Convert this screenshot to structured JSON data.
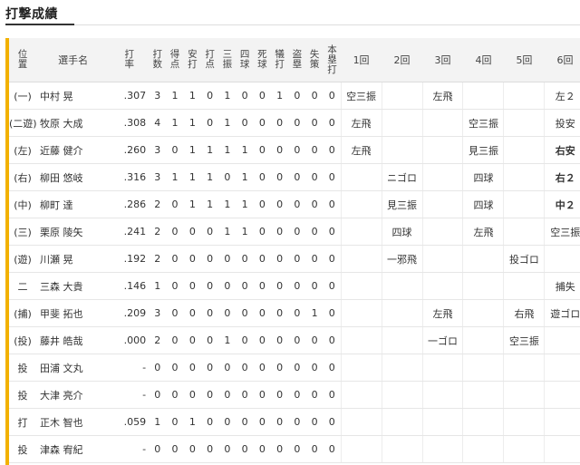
{
  "section_title": "打撃成績",
  "headers": {
    "pos": "位置",
    "name": "選手名",
    "avg": "打率",
    "ab": "打数",
    "r": "得点",
    "h": "安打",
    "rbi": "打点",
    "so": "三振",
    "bb": "四球",
    "hbp": "死球",
    "sac": "犠打",
    "sb": "盗塁",
    "err": "失策",
    "hr": "本塁打",
    "innings": [
      "1回",
      "2回",
      "3回",
      "4回",
      "5回",
      "6回"
    ]
  },
  "players": [
    {
      "pos": "(一)",
      "name": "中村 晃",
      "avg": ".307",
      "ab": "3",
      "r": "1",
      "h": "1",
      "rbi": "0",
      "so": "1",
      "bb": "0",
      "hbp": "0",
      "sac": "1",
      "sb": "0",
      "err": "0",
      "hr": "0",
      "innings": [
        "空三振",
        "",
        "左飛",
        "",
        "",
        "左２"
      ],
      "styles": [
        "",
        "",
        "",
        "",
        "",
        "hit"
      ]
    },
    {
      "pos": "(二遊)",
      "name": "牧原 大成",
      "avg": ".308",
      "ab": "4",
      "r": "1",
      "h": "1",
      "rbi": "0",
      "so": "1",
      "bb": "0",
      "hbp": "0",
      "sac": "0",
      "sb": "0",
      "err": "0",
      "hr": "0",
      "innings": [
        "左飛",
        "",
        "",
        "空三振",
        "",
        "投安"
      ],
      "styles": [
        "",
        "",
        "",
        "",
        "",
        "hit"
      ]
    },
    {
      "pos": "(左)",
      "name": "近藤 健介",
      "avg": ".260",
      "ab": "3",
      "r": "0",
      "h": "1",
      "rbi": "1",
      "so": "1",
      "bb": "1",
      "hbp": "0",
      "sac": "0",
      "sb": "0",
      "err": "0",
      "hr": "0",
      "innings": [
        "左飛",
        "",
        "",
        "見三振",
        "",
        "右安"
      ],
      "styles": [
        "",
        "",
        "",
        "",
        "",
        "hit-bold"
      ]
    },
    {
      "pos": "(右)",
      "name": "柳田 悠岐",
      "avg": ".316",
      "ab": "3",
      "r": "1",
      "h": "1",
      "rbi": "1",
      "so": "0",
      "bb": "1",
      "hbp": "0",
      "sac": "0",
      "sb": "0",
      "err": "0",
      "hr": "0",
      "innings": [
        "",
        "ニゴロ",
        "",
        "四球",
        "",
        "右２"
      ],
      "styles": [
        "",
        "",
        "",
        "",
        "",
        "hit-bold"
      ]
    },
    {
      "pos": "(中)",
      "name": "柳町 達",
      "avg": ".286",
      "ab": "2",
      "r": "0",
      "h": "1",
      "rbi": "1",
      "so": "1",
      "bb": "1",
      "hbp": "0",
      "sac": "0",
      "sb": "0",
      "err": "0",
      "hr": "0",
      "innings": [
        "",
        "見三振",
        "",
        "四球",
        "",
        "中２"
      ],
      "styles": [
        "",
        "",
        "",
        "",
        "",
        "hit-bold"
      ]
    },
    {
      "pos": "(三)",
      "name": "栗原 陵矢",
      "avg": ".241",
      "ab": "2",
      "r": "0",
      "h": "0",
      "rbi": "0",
      "so": "1",
      "bb": "1",
      "hbp": "0",
      "sac": "0",
      "sb": "0",
      "err": "0",
      "hr": "0",
      "innings": [
        "",
        "四球",
        "",
        "左飛",
        "",
        "空三振"
      ],
      "styles": [
        "",
        "",
        "",
        "",
        "",
        ""
      ]
    },
    {
      "pos": "(遊)",
      "name": "川瀬 晃",
      "avg": ".192",
      "ab": "2",
      "r": "0",
      "h": "0",
      "rbi": "0",
      "so": "0",
      "bb": "0",
      "hbp": "0",
      "sac": "0",
      "sb": "0",
      "err": "0",
      "hr": "0",
      "innings": [
        "",
        "一邪飛",
        "",
        "",
        "投ゴロ",
        ""
      ],
      "styles": [
        "",
        "",
        "",
        "",
        "",
        ""
      ]
    },
    {
      "pos": "二",
      "name": "三森 大貴",
      "avg": ".146",
      "ab": "1",
      "r": "0",
      "h": "0",
      "rbi": "0",
      "so": "0",
      "bb": "0",
      "hbp": "0",
      "sac": "0",
      "sb": "0",
      "err": "0",
      "hr": "0",
      "innings": [
        "",
        "",
        "",
        "",
        "",
        "捕失"
      ],
      "styles": [
        "",
        "",
        "",
        "",
        "",
        ""
      ]
    },
    {
      "pos": "(捕)",
      "name": "甲斐 拓也",
      "avg": ".209",
      "ab": "3",
      "r": "0",
      "h": "0",
      "rbi": "0",
      "so": "0",
      "bb": "0",
      "hbp": "0",
      "sac": "0",
      "sb": "0",
      "err": "1",
      "hr": "0",
      "innings": [
        "",
        "",
        "左飛",
        "",
        "右飛",
        "遊ゴロ"
      ],
      "styles": [
        "",
        "",
        "",
        "",
        "",
        ""
      ]
    },
    {
      "pos": "(投)",
      "name": "藤井 皓哉",
      "avg": ".000",
      "ab": "2",
      "r": "0",
      "h": "0",
      "rbi": "0",
      "so": "1",
      "bb": "0",
      "hbp": "0",
      "sac": "0",
      "sb": "0",
      "err": "0",
      "hr": "0",
      "innings": [
        "",
        "",
        "一ゴロ",
        "",
        "空三振",
        ""
      ],
      "styles": [
        "",
        "",
        "",
        "",
        "",
        ""
      ]
    },
    {
      "pos": "投",
      "name": "田浦 文丸",
      "avg": "-",
      "ab": "0",
      "r": "0",
      "h": "0",
      "rbi": "0",
      "so": "0",
      "bb": "0",
      "hbp": "0",
      "sac": "0",
      "sb": "0",
      "err": "0",
      "hr": "0",
      "innings": [
        "",
        "",
        "",
        "",
        "",
        ""
      ],
      "styles": [
        "",
        "",
        "",
        "",
        "",
        ""
      ]
    },
    {
      "pos": "投",
      "name": "大津 亮介",
      "avg": "-",
      "ab": "0",
      "r": "0",
      "h": "0",
      "rbi": "0",
      "so": "0",
      "bb": "0",
      "hbp": "0",
      "sac": "0",
      "sb": "0",
      "err": "0",
      "hr": "0",
      "innings": [
        "",
        "",
        "",
        "",
        "",
        ""
      ],
      "styles": [
        "",
        "",
        "",
        "",
        "",
        ""
      ]
    },
    {
      "pos": "打",
      "name": "正木 智也",
      "avg": ".059",
      "ab": "1",
      "r": "0",
      "h": "1",
      "rbi": "0",
      "so": "0",
      "bb": "0",
      "hbp": "0",
      "sac": "0",
      "sb": "0",
      "err": "0",
      "hr": "0",
      "innings": [
        "",
        "",
        "",
        "",
        "",
        ""
      ],
      "styles": [
        "",
        "",
        "",
        "",
        "",
        ""
      ]
    },
    {
      "pos": "投",
      "name": "津森 宥紀",
      "avg": "-",
      "ab": "0",
      "r": "0",
      "h": "0",
      "rbi": "0",
      "so": "0",
      "bb": "0",
      "hbp": "0",
      "sac": "0",
      "sb": "0",
      "err": "0",
      "hr": "0",
      "innings": [
        "",
        "",
        "",
        "",
        "",
        ""
      ],
      "styles": [
        "",
        "",
        "",
        "",
        "",
        ""
      ]
    }
  ]
}
